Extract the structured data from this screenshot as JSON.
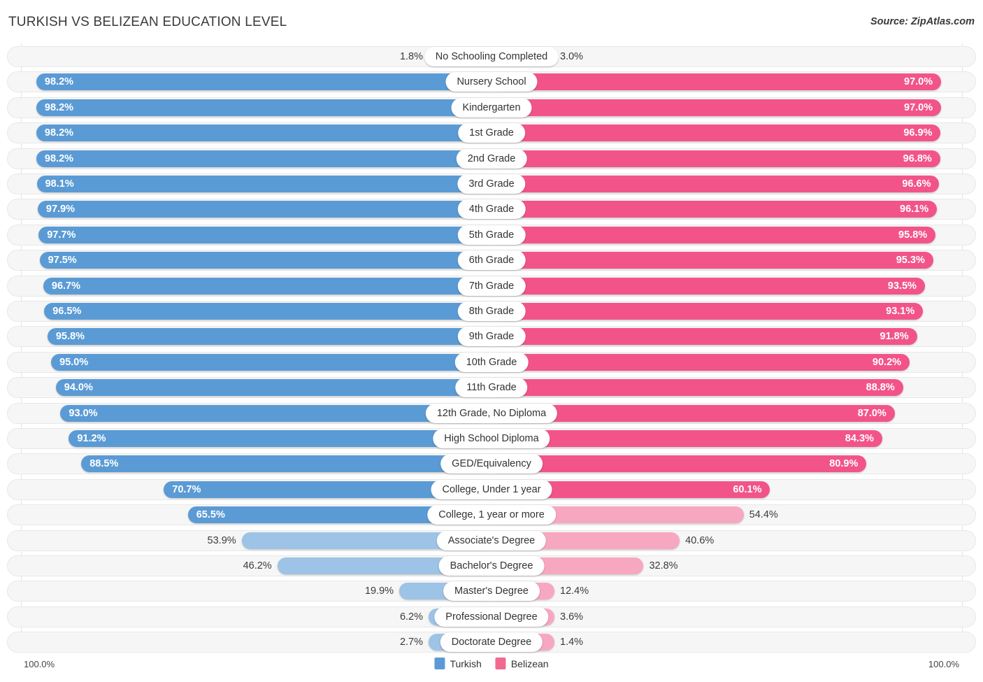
{
  "header": {
    "title": "TURKISH VS BELIZEAN EDUCATION LEVEL",
    "source": "Source: ZipAtlas.com"
  },
  "footer": {
    "axis_left": "100.0%",
    "axis_right": "100.0%",
    "legend": [
      {
        "label": "Turkish",
        "color": "#5b9bd5"
      },
      {
        "label": "Belizean",
        "color": "#f2688f"
      }
    ]
  },
  "colors": {
    "turkish_strong": "#5b9bd5",
    "turkish_light": "#9dc3e6",
    "belizean_strong": "#f2548a",
    "belizean_light": "#f7a8c0",
    "track": "#f6f6f6",
    "track_border": "#e8e8e8",
    "gridline": "#e3e3e3",
    "text_dark": "#3b3b3b"
  },
  "chart_data": {
    "type": "bar",
    "orientation": "horizontal-diverging",
    "title": "TURKISH VS BELIZEAN EDUCATION LEVEL",
    "source": "Source: ZipAtlas.com",
    "xlabel": "",
    "ylabel": "",
    "xlim": [
      0,
      100
    ],
    "unit": "%",
    "grid": true,
    "legend_position": "bottom-center",
    "categories": [
      "No Schooling Completed",
      "Nursery School",
      "Kindergarten",
      "1st Grade",
      "2nd Grade",
      "3rd Grade",
      "4th Grade",
      "5th Grade",
      "6th Grade",
      "7th Grade",
      "8th Grade",
      "9th Grade",
      "10th Grade",
      "11th Grade",
      "12th Grade, No Diploma",
      "High School Diploma",
      "GED/Equivalency",
      "College, Under 1 year",
      "College, 1 year or more",
      "Associate's Degree",
      "Bachelor's Degree",
      "Master's Degree",
      "Professional Degree",
      "Doctorate Degree"
    ],
    "series": [
      {
        "name": "Turkish",
        "color": "#5b9bd5",
        "values": [
          1.8,
          98.2,
          98.2,
          98.2,
          98.2,
          98.1,
          97.9,
          97.7,
          97.5,
          96.7,
          96.5,
          95.8,
          95.0,
          94.0,
          93.0,
          91.2,
          88.5,
          70.7,
          65.5,
          53.9,
          46.2,
          19.9,
          6.2,
          2.7
        ],
        "labels": [
          "1.8%",
          "98.2%",
          "98.2%",
          "98.2%",
          "98.2%",
          "98.1%",
          "97.9%",
          "97.7%",
          "97.5%",
          "96.7%",
          "96.5%",
          "95.8%",
          "95.0%",
          "94.0%",
          "93.0%",
          "91.2%",
          "88.5%",
          "70.7%",
          "65.5%",
          "53.9%",
          "46.2%",
          "19.9%",
          "6.2%",
          "2.7%"
        ]
      },
      {
        "name": "Belizean",
        "color": "#f2548a",
        "values": [
          3.0,
          97.0,
          97.0,
          96.9,
          96.8,
          96.6,
          96.1,
          95.8,
          95.3,
          93.5,
          93.1,
          91.8,
          90.2,
          88.8,
          87.0,
          84.3,
          80.9,
          60.1,
          54.4,
          40.6,
          32.8,
          12.4,
          3.6,
          1.4
        ],
        "labels": [
          "3.0%",
          "97.0%",
          "97.0%",
          "96.9%",
          "96.8%",
          "96.6%",
          "96.1%",
          "95.8%",
          "95.3%",
          "93.5%",
          "93.1%",
          "91.8%",
          "90.2%",
          "88.8%",
          "87.0%",
          "84.3%",
          "80.9%",
          "60.1%",
          "54.4%",
          "40.6%",
          "32.8%",
          "12.4%",
          "3.6%",
          "1.4%"
        ]
      }
    ]
  }
}
